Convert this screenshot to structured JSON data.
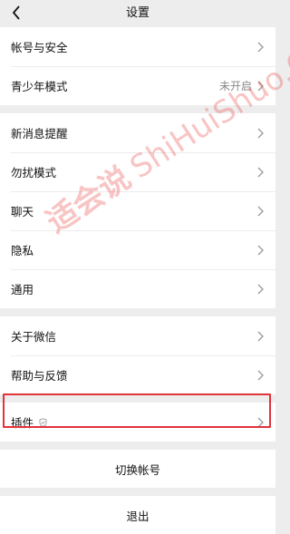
{
  "nav": {
    "title": "设置"
  },
  "groups": [
    {
      "items": [
        {
          "label": "帐号与安全"
        },
        {
          "label": "青少年模式",
          "value": "未开启"
        }
      ]
    },
    {
      "items": [
        {
          "label": "新消息提醒"
        },
        {
          "label": "勿扰模式"
        },
        {
          "label": "聊天"
        },
        {
          "label": "隐私"
        },
        {
          "label": "通用"
        }
      ]
    },
    {
      "items": [
        {
          "label": "关于微信"
        },
        {
          "label": "帮助与反馈"
        }
      ]
    },
    {
      "items": [
        {
          "label": "插件",
          "icon": "shield-icon"
        }
      ]
    }
  ],
  "switch_account": "切换帐号",
  "logout": "退出",
  "watermark": {
    "cn": "适会说",
    "en": "ShiHuiShuo.Com"
  },
  "colors": {
    "highlight": "#e0333a",
    "watermark": "#e84848"
  }
}
